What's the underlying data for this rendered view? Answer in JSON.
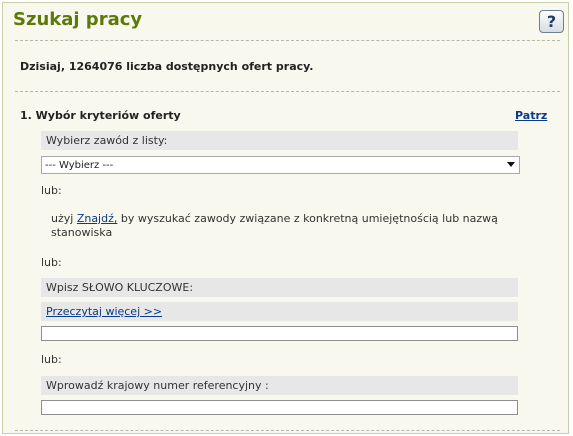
{
  "header": {
    "title": "Szukaj pracy",
    "help_label": "?"
  },
  "info": {
    "text": "Dzisiaj, 1264076 liczba dostępnych ofert pracy."
  },
  "section": {
    "title": "1. Wybór kryteriów oferty",
    "link": "Patrz"
  },
  "occupation": {
    "label": "Wybierz zawód z listy:",
    "selected": "--- Wybierz ---"
  },
  "or_label": "lub:",
  "find": {
    "prefix": "użyj ",
    "link": "Znajdź,",
    "suffix": " by wyszukać zawody związane z konkretną umiejętnością lub nazwą stanowiska"
  },
  "keyword": {
    "label": "Wpisz SŁOWO KLUCZOWE:",
    "read_more": "Przeczytaj więcej >>",
    "value": ""
  },
  "reference": {
    "label": "Wprowadź krajowy numer referencyjny :",
    "value": ""
  }
}
